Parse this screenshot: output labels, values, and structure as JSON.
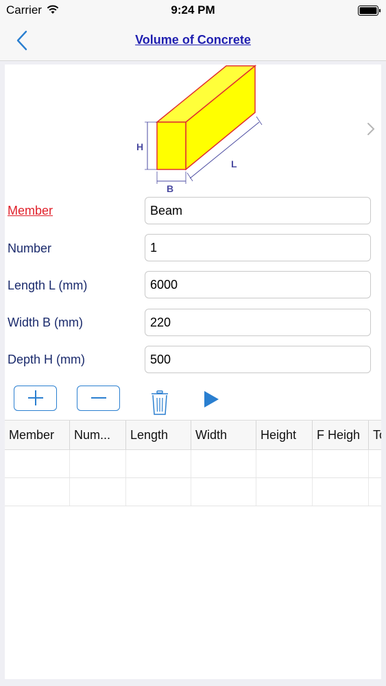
{
  "status_bar": {
    "carrier": "Carrier",
    "time": "9:24 PM"
  },
  "nav": {
    "title": "Volume of Concrete",
    "back_icon": "chevron-left-icon"
  },
  "illustration": {
    "h_label": "H",
    "b_label": "B",
    "l_label": "L",
    "fill_color": "#ffff00",
    "edge_color": "#e03030",
    "dimension_color": "#4a4aa0"
  },
  "form": {
    "member": {
      "label": "Member",
      "value": "Beam"
    },
    "number": {
      "label": "Number",
      "value": "1"
    },
    "length": {
      "label": "Length L (mm)",
      "value": "6000"
    },
    "width": {
      "label": "Width B (mm)",
      "value": "220"
    },
    "depth": {
      "label": "Depth H (mm)",
      "value": "500"
    }
  },
  "toolbar": {
    "add_icon": "plus-icon",
    "remove_icon": "minus-icon",
    "delete_icon": "trash-icon",
    "calculate_icon": "play-icon",
    "accent_color": "#2a7fd0"
  },
  "table": {
    "columns": [
      "Member",
      "Num...",
      "Length",
      "Width",
      "Height",
      "F Heigh",
      "To"
    ],
    "rows": [
      [
        "",
        "",
        "",
        "",
        "",
        "",
        ""
      ],
      [
        "",
        "",
        "",
        "",
        "",
        "",
        ""
      ]
    ]
  }
}
